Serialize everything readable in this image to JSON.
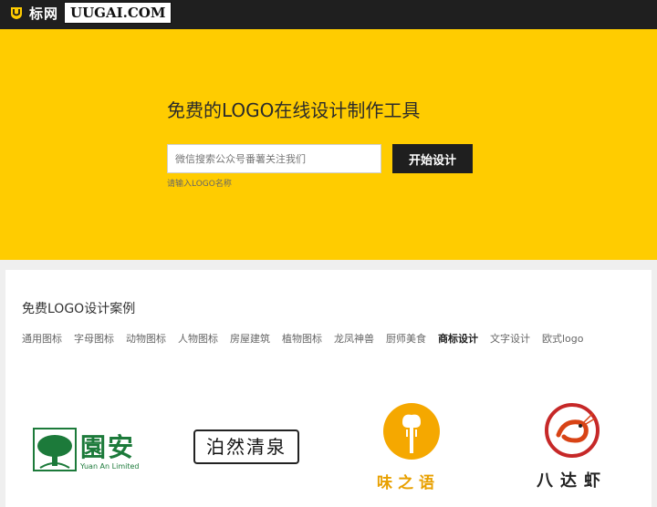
{
  "brand": {
    "cn": "标网",
    "domain": "UUGAI.COM"
  },
  "hero": {
    "title": "免费的LOGO在线设计制作工具",
    "search_placeholder": "微信搜索公众号番薯关注我们",
    "button_label": "开始设计",
    "hint": "请输入LOGO名称",
    "bg_color": "#ffcc00"
  },
  "cases": {
    "title": "免费LOGO设计案例",
    "categories": [
      "通用图标",
      "字母图标",
      "动物图标",
      "人物图标",
      "房屋建筑",
      "植物图标",
      "龙凤神兽",
      "厨师美食",
      "商标设计",
      "文字设计",
      "欧式logo"
    ],
    "active_category": "商标设计",
    "logos": [
      {
        "cn": "園安",
        "en": "Yuan An Limited",
        "icon": "tree-icon"
      },
      {
        "cn": "泊然清泉",
        "icon": "text-logo"
      },
      {
        "cn": "味之语",
        "icon": "chef-hat-fork-icon"
      },
      {
        "cn": "八达虾",
        "icon": "shrimp-icon"
      }
    ]
  }
}
